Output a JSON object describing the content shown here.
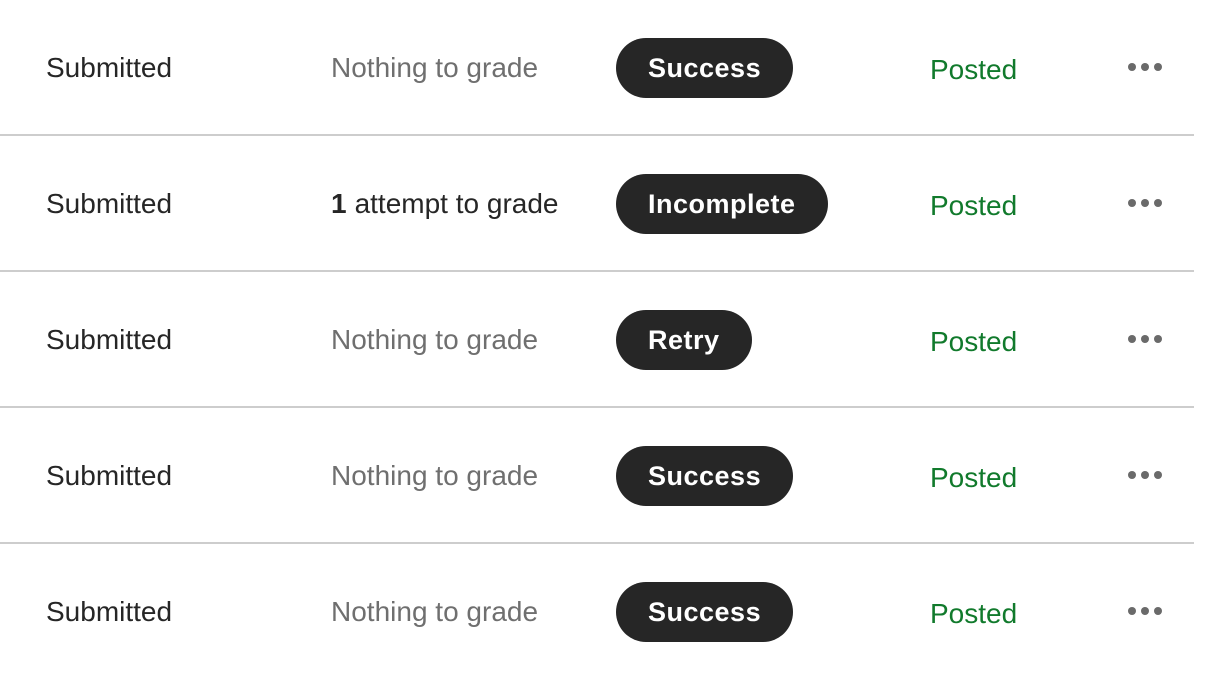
{
  "rows": [
    {
      "status": "Submitted",
      "grade_count": "",
      "grade_text": "Nothing to grade",
      "grade_active": false,
      "badge": "Success",
      "posted": "Posted",
      "menu_icon": "more-horizontal-icon"
    },
    {
      "status": "Submitted",
      "grade_count": "1",
      "grade_text": "attempt to grade",
      "grade_active": true,
      "badge": "Incomplete",
      "posted": "Posted",
      "menu_icon": "more-horizontal-icon"
    },
    {
      "status": "Submitted",
      "grade_count": "",
      "grade_text": "Nothing to grade",
      "grade_active": false,
      "badge": "Retry",
      "posted": "Posted",
      "menu_icon": "more-horizontal-icon"
    },
    {
      "status": "Submitted",
      "grade_count": "",
      "grade_text": "Nothing to grade",
      "grade_active": false,
      "badge": "Success",
      "posted": "Posted",
      "menu_icon": "more-horizontal-icon"
    },
    {
      "status": "Submitted",
      "grade_count": "",
      "grade_text": "Nothing to grade",
      "grade_active": false,
      "badge": "Success",
      "posted": "Posted",
      "menu_icon": "more-horizontal-icon"
    }
  ],
  "colors": {
    "badge_bg": "#262626",
    "posted": "#117a2c",
    "muted_text": "#6f6f6f",
    "text": "#262626"
  }
}
